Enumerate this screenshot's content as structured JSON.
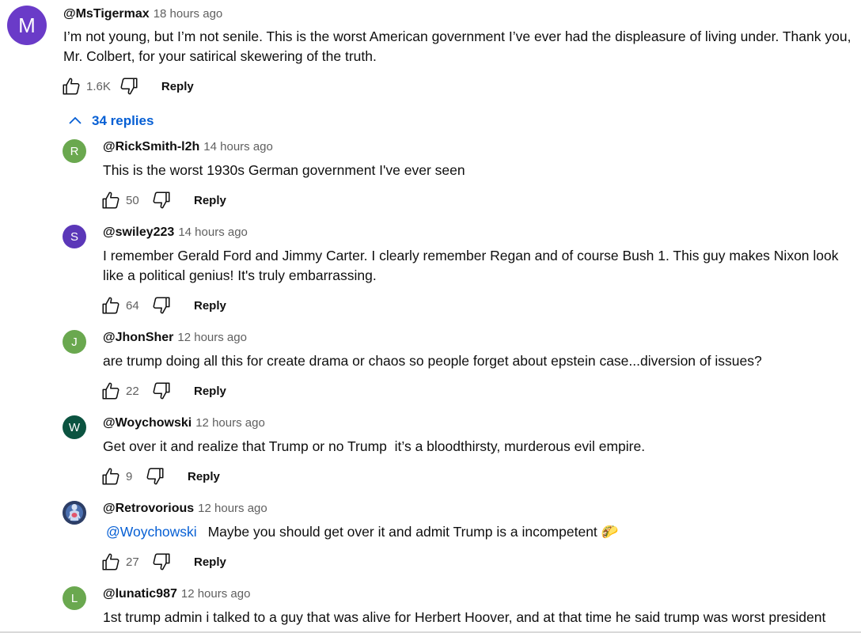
{
  "colors": {
    "avatar_m": "#6a3bc8",
    "avatar_r": "#6aa84f",
    "avatar_s": "#5b37b8",
    "avatar_j": "#6aa84f",
    "avatar_w": "#0b5340",
    "avatar_l": "#6aa84f",
    "link_blue": "#065fd4"
  },
  "top_comment": {
    "avatar_letter": "M",
    "handle": "@MsTigermax",
    "time": "18 hours ago",
    "text": "I’m not young, but I’m not senile. This is the worst American government I’ve ever had the displeasure of living under. Thank you, Mr. Colbert, for your satirical skewering of the truth.",
    "likes": "1.6K",
    "reply_label": "Reply",
    "replies_label": "34 replies"
  },
  "replies": [
    {
      "avatar_letter": "R",
      "handle": "@RickSmith-l2h",
      "time": "14 hours ago",
      "text": "This is the worst 1930s German government I've ever seen",
      "likes": "50",
      "reply_label": "Reply"
    },
    {
      "avatar_letter": "S",
      "handle": "@swiley223",
      "time": "14 hours ago",
      "text": "I remember Gerald Ford and Jimmy Carter. I clearly remember Regan and of course Bush 1. This guy makes Nixon look like a political genius! It's truly embarrassing.",
      "likes": "64",
      "reply_label": "Reply"
    },
    {
      "avatar_letter": "J",
      "handle": "@JhonSher",
      "time": "12 hours ago",
      "text": "are trump doing all this for create drama or chaos so people forget about epstein case...diversion of issues?",
      "likes": "22",
      "reply_label": "Reply"
    },
    {
      "avatar_letter": "W",
      "handle": "@Woychowski",
      "time": "12 hours ago",
      "text": "Get over it and realize that Trump or no Trump  it’s a bloodthirsty, murderous evil empire.",
      "likes": "9",
      "reply_label": "Reply"
    },
    {
      "avatar_icon": "anatomy-avatar-icon",
      "handle": "@Retrovorious",
      "time": "12 hours ago",
      "mention": "@Woychowski",
      "text": "Maybe you should get over it and admit Trump is a incompetent",
      "emoji": "🌮",
      "likes": "27",
      "reply_label": "Reply"
    },
    {
      "avatar_letter": "L",
      "handle": "@lunatic987",
      "time": "12 hours ago",
      "text": "1st trump admin i talked to a guy that was alive for Herbert Hoover, and at that time he said trump was worst president"
    }
  ]
}
